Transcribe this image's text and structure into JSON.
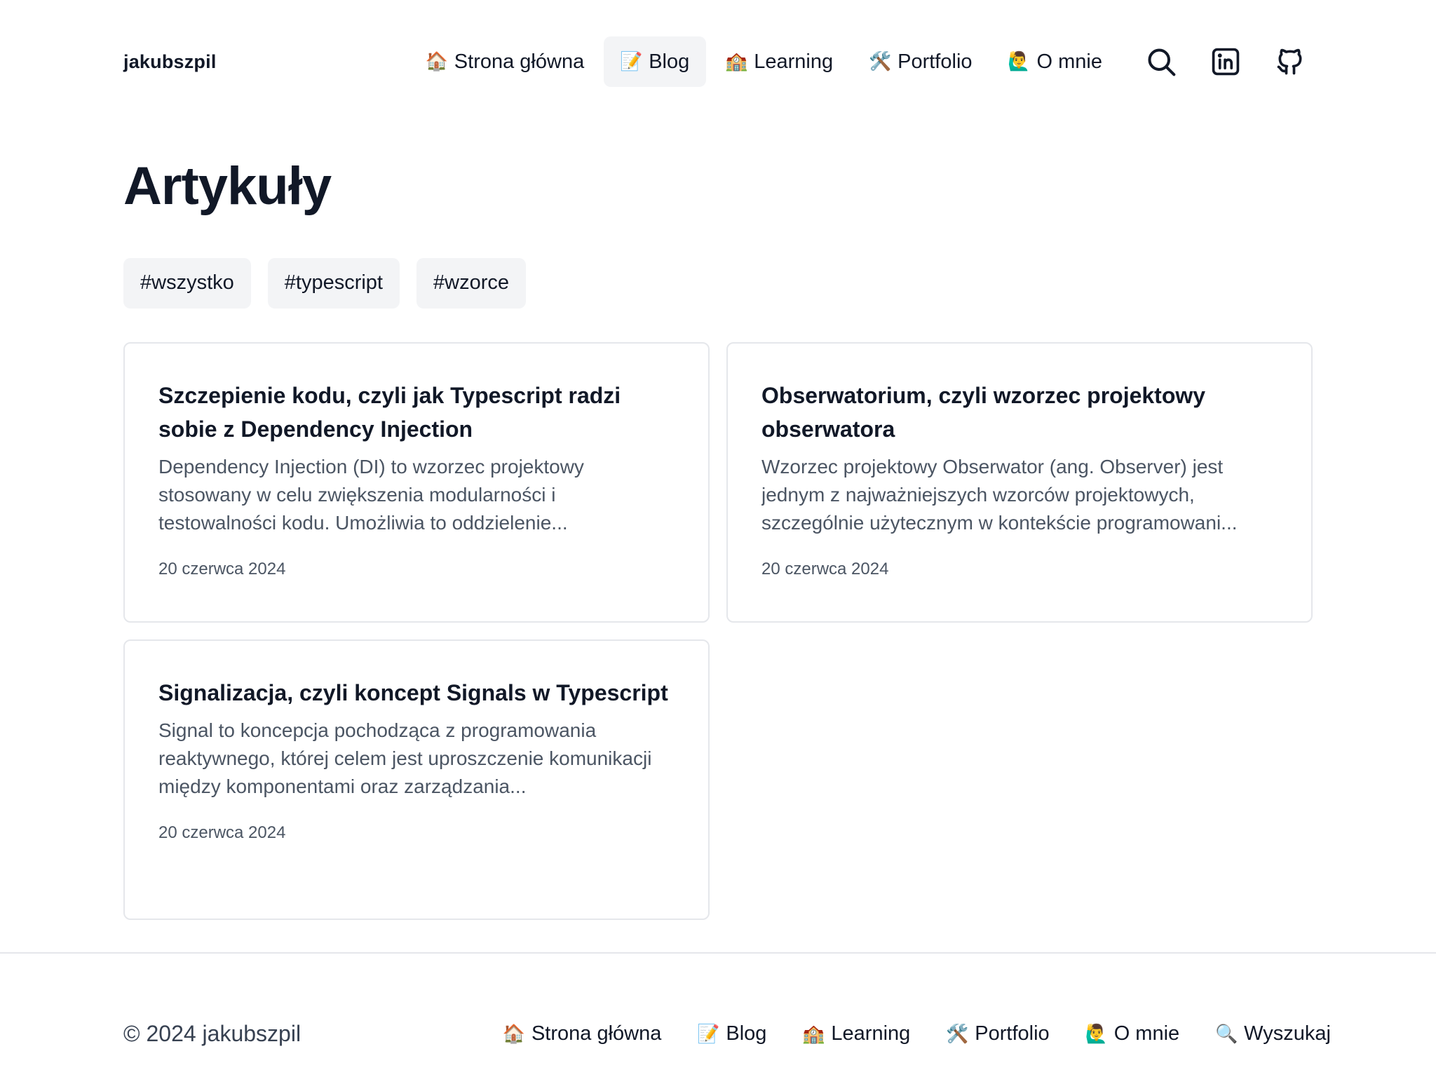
{
  "header": {
    "brand": "jakubszpil",
    "nav": [
      {
        "emoji": "🏠",
        "label": "Strona główna"
      },
      {
        "emoji": "📝",
        "label": "Blog"
      },
      {
        "emoji": "🏫",
        "label": "Learning"
      },
      {
        "emoji": "🛠️",
        "label": "Portfolio"
      },
      {
        "emoji": "🙋‍♂️",
        "label": "O mnie"
      }
    ],
    "icons": [
      "search-icon",
      "linkedin-icon",
      "github-icon"
    ]
  },
  "main": {
    "title": "Artykuły",
    "tags": [
      "#wszystko",
      "#typescript",
      "#wzorce"
    ],
    "articles": [
      {
        "title": "Szczepienie kodu, czyli jak Typescript radzi sobie z Dependency Injection",
        "description": "Dependency Injection (DI) to wzorzec projektowy stosowany w celu zwiększenia modularności i testowalności kodu. Umożliwia to oddzielenie...",
        "date": "20 czerwca 2024"
      },
      {
        "title": "Obserwatorium, czyli wzorzec projektowy obserwatora",
        "description": "Wzorzec projektowy Obserwator (ang. Observer) jest jednym z najważniejszych wzorców projektowych, szczególnie użytecznym w kontekście programowani...",
        "date": "20 czerwca 2024"
      },
      {
        "title": "Signalizacja, czyli koncept Signals w Typescript",
        "description": "Signal to koncepcja pochodząca z programowania reaktywnego, której celem jest uproszczenie komunikacji między komponentami oraz zarządzania...",
        "date": "20 czerwca 2024"
      }
    ]
  },
  "footer": {
    "copyright": "© 2024 jakubszpil",
    "nav": [
      {
        "emoji": "🏠",
        "label": "Strona główna"
      },
      {
        "emoji": "📝",
        "label": "Blog"
      },
      {
        "emoji": "🏫",
        "label": "Learning"
      },
      {
        "emoji": "🛠️",
        "label": "Portfolio"
      },
      {
        "emoji": "🙋‍♂️",
        "label": "O mnie"
      },
      {
        "emoji": "🔍",
        "label": "Wyszukaj"
      }
    ]
  },
  "colors": {
    "text": "#111827",
    "muted": "#4b5563",
    "pill_bg": "#f3f4f6",
    "border": "#e5e7eb"
  }
}
